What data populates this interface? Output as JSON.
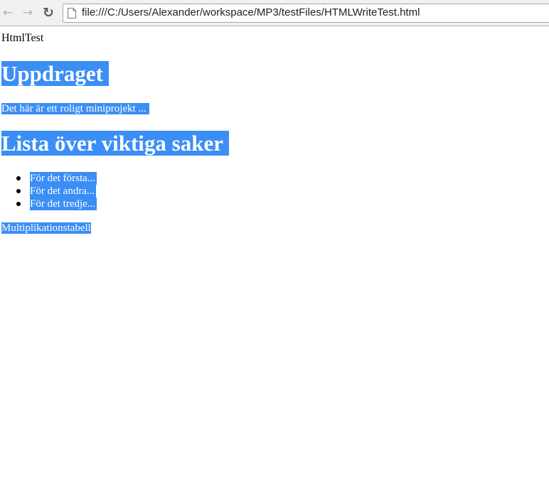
{
  "browser": {
    "url": "file:///C:/Users/Alexander/workspace/MP3/testFiles/HTMLWriteTest.html"
  },
  "page": {
    "title_text": "HtmlTest",
    "heading1": "Uppdraget",
    "paragraph1": "Det här är ett roligt miniprojekt ...",
    "heading2": "Lista över viktiga saker",
    "list_items": [
      "För det första...",
      "För det andra...",
      "För det tredje..."
    ],
    "paragraph2": "Multiplikationstabell"
  },
  "colors": {
    "selection_highlight": "#3b8ef5",
    "toolbar_bg": "#f1f1f1"
  }
}
